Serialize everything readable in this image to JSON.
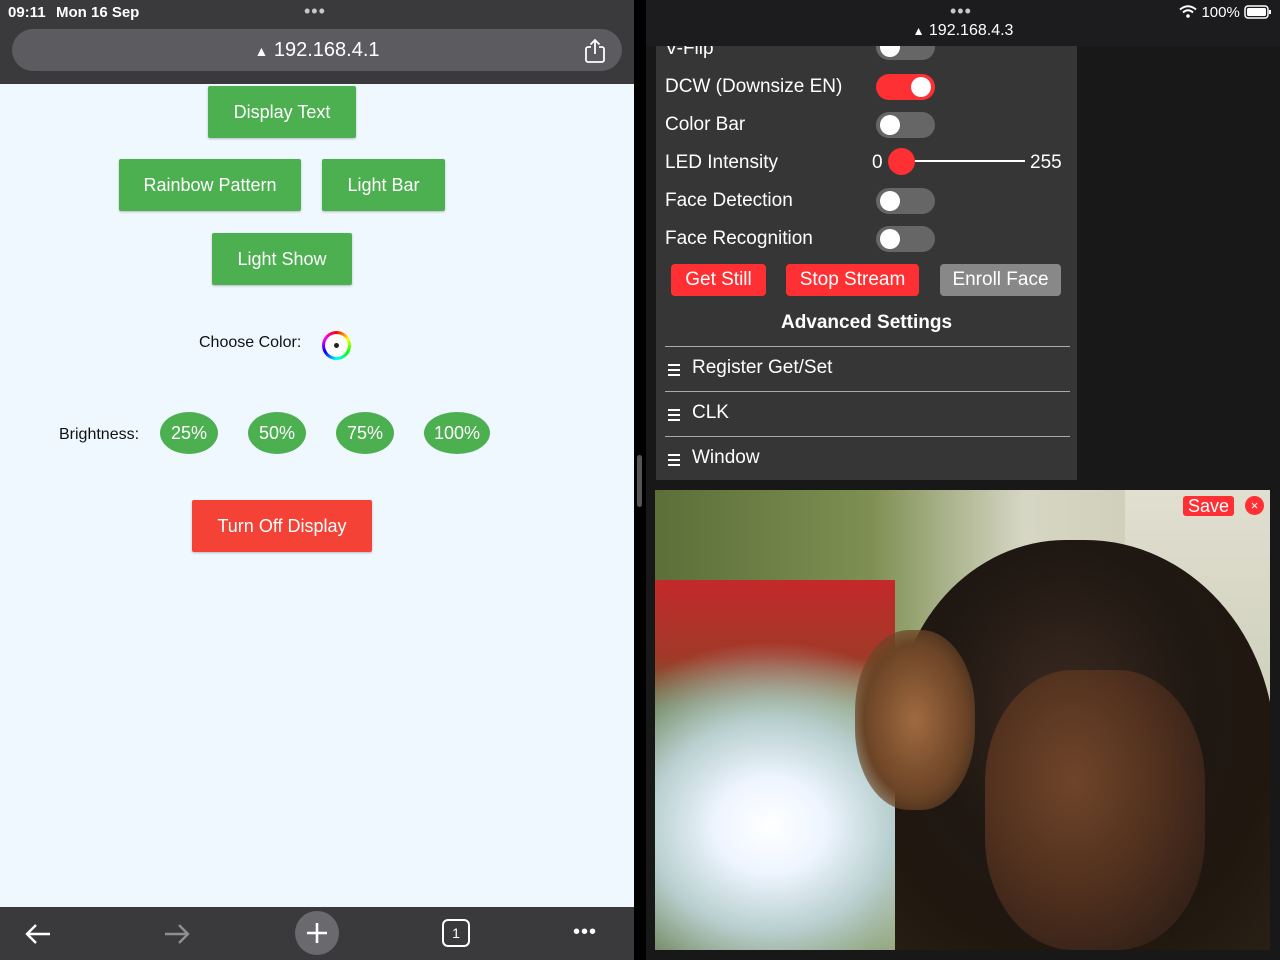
{
  "status_bar": {
    "time": "09:11",
    "date": "Mon 16 Sep",
    "battery": "100%"
  },
  "left_browser": {
    "url": "192.168.4.1",
    "buttons": {
      "display_text": "Display Text",
      "rainbow_pattern": "Rainbow Pattern",
      "light_bar": "Light Bar",
      "light_show": "Light Show",
      "turn_off_display": "Turn Off Display"
    },
    "choose_color_label": "Choose Color:",
    "brightness_label": "Brightness:",
    "brightness_options": [
      "25%",
      "50%",
      "75%",
      "100%"
    ],
    "tab_count": "1"
  },
  "right_browser": {
    "url": "192.168.4.3",
    "partial_row_label": "V-Flip",
    "settings": {
      "dcw_label": "DCW (Downsize EN)",
      "dcw_on": true,
      "color_bar_label": "Color Bar",
      "color_bar_on": false,
      "led_label": "LED Intensity",
      "led_min": "0",
      "led_max": "255",
      "led_value": 0,
      "face_detection_label": "Face Detection",
      "face_detection_on": false,
      "face_recognition_label": "Face Recognition",
      "face_recognition_on": false
    },
    "buttons": {
      "get_still": "Get Still",
      "stop_stream": "Stop Stream",
      "enroll_face": "Enroll Face"
    },
    "advanced_title": "Advanced Settings",
    "advanced_items": [
      "Register Get/Set",
      "CLK",
      "Window"
    ],
    "stream": {
      "save_label": "Save",
      "close_label": "×"
    }
  },
  "colors": {
    "green": "#4caf50",
    "red": "#f44336",
    "toggle_on": "#ff3034",
    "page_bg": "#f0f8ff",
    "panel_bg": "#363636"
  }
}
